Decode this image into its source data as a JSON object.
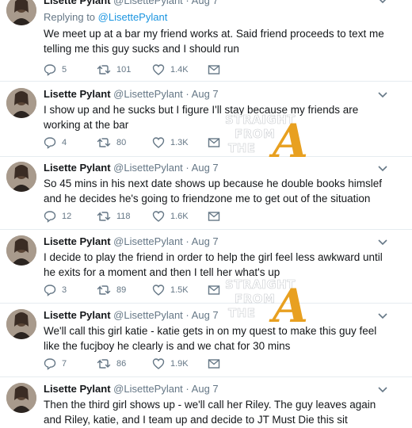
{
  "tweets": [
    {
      "name": "Lisette Pylant",
      "handle": "@LisettePylant",
      "time": "Aug 7",
      "replying_prefix": "Replying to",
      "replying_handle": "@LisettePylant",
      "text": "We meet up at a bar my friend works at. Said friend proceeds to text me telling me this guy sucks and I should run",
      "replies": "5",
      "retweets": "101",
      "likes": "1.4K"
    },
    {
      "name": "Lisette Pylant",
      "handle": "@LisettePylant",
      "time": "Aug 7",
      "text": "I show up and he sucks but I figure I'll stay because my friends are working at the bar",
      "replies": "4",
      "retweets": "80",
      "likes": "1.3K"
    },
    {
      "name": "Lisette Pylant",
      "handle": "@LisettePylant",
      "time": "Aug 7",
      "text": "So 45 mins in his next date shows up because he double books himslef and he decides he's going to friendzone me to get out of the situation",
      "replies": "12",
      "retweets": "118",
      "likes": "1.6K"
    },
    {
      "name": "Lisette Pylant",
      "handle": "@LisettePylant",
      "time": "Aug 7",
      "text": "I decide to play the friend in order to help the girl feel less awkward until he exits for a moment and then I tell her what's up",
      "replies": "3",
      "retweets": "89",
      "likes": "1.5K"
    },
    {
      "name": "Lisette Pylant",
      "handle": "@LisettePylant",
      "time": "Aug 7",
      "text": "We'll call this girl katie - katie gets in on my quest to make this guy feel like the fucjboy he clearly is and we chat for 30 mins",
      "replies": "7",
      "retweets": "86",
      "likes": "1.9K"
    },
    {
      "name": "Lisette Pylant",
      "handle": "@LisettePylant",
      "time": "Aug 7",
      "text": "Then the third girl shows up - we'll call her Riley. The guy leaves again and Riley, katie, and I team up and decide to JT Must Die this sit"
    }
  ],
  "watermark": {
    "line1": "STRAIGHT",
    "line2": "FROM",
    "line3": "THE",
    "logo_letter": "A",
    "logo_color": "#e8a020"
  },
  "colors": {
    "link": "#1b95e0",
    "meta": "#657786",
    "text": "#14171a",
    "separator": "#e6ecf0"
  },
  "icons": [
    "reply-icon",
    "retweet-icon",
    "like-icon",
    "message-icon",
    "chevron-down-icon"
  ]
}
